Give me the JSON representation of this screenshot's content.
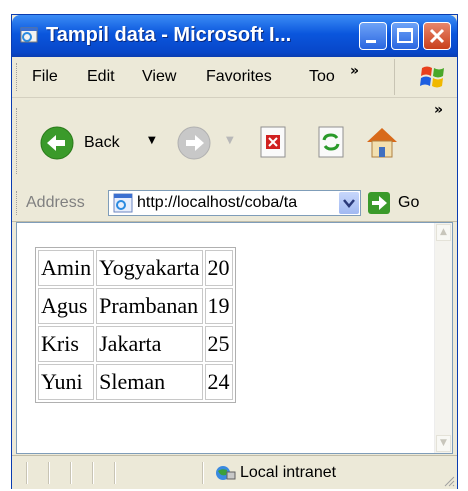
{
  "window": {
    "title": "Tampil data - Microsoft I..."
  },
  "menu": {
    "items": [
      "File",
      "Edit",
      "View",
      "Favorites",
      "Too"
    ],
    "overflow": "»"
  },
  "toolbar": {
    "back_label": "Back",
    "overflow": "»"
  },
  "address": {
    "label": "Address",
    "url": "http://localhost/coba/ta",
    "go_label": "Go"
  },
  "table": {
    "rows": [
      [
        "Amin",
        "Yogyakarta",
        "20"
      ],
      [
        "Agus",
        "Prambanan",
        "19"
      ],
      [
        "Kris",
        "Jakarta",
        "25"
      ],
      [
        "Yuni",
        "Sleman",
        "24"
      ]
    ]
  },
  "status": {
    "zone": "Local intranet"
  },
  "icons": [
    "ie-window-icon",
    "minimize-icon",
    "maximize-icon",
    "close-icon",
    "windows-logo-icon",
    "back-arrow-icon",
    "forward-arrow-icon",
    "stop-icon",
    "refresh-icon",
    "home-icon",
    "page-icon",
    "go-arrow-icon",
    "intranet-globe-icon"
  ],
  "colors": {
    "titlebar": "#0a56dd",
    "close_button": "#c9401c",
    "chrome": "#ece9d8",
    "back_button": "#3a9a2a"
  }
}
